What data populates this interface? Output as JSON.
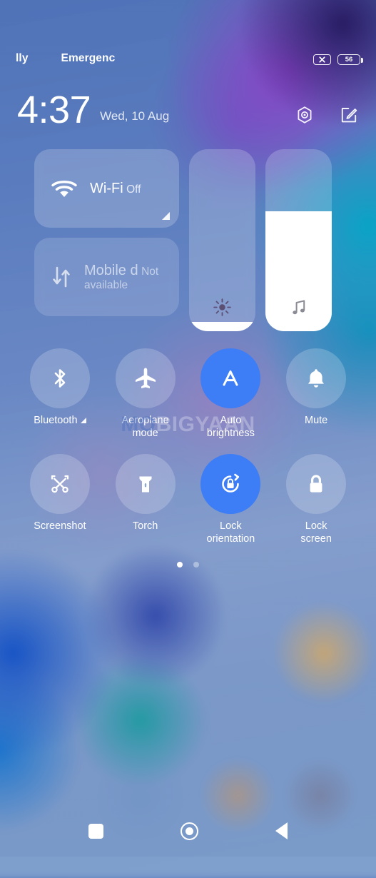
{
  "statusbar": {
    "carrier_left": "lly",
    "carrier_right": "Emergenc",
    "sim_icon": "no-sim-icon",
    "battery_percent": "56"
  },
  "clock": {
    "time": "4:37",
    "date": "Wed, 10 Aug",
    "settings_icon": "settings-hexagon-icon",
    "edit_icon": "edit-tiles-icon"
  },
  "tiles": {
    "wifi": {
      "title": "Wi-Fi",
      "status": "Off",
      "icon": "wifi-icon",
      "expandable": true
    },
    "mobile": {
      "title": "Mobile d",
      "status": "Not available",
      "icon": "mobile-data-icon",
      "expandable": false
    },
    "brightness_slider": {
      "icon": "brightness-sun-icon",
      "level_percent": 5,
      "label": "Brightness"
    },
    "volume_slider": {
      "icon": "music-note-icon",
      "level_percent": 66,
      "label": "Media volume"
    }
  },
  "toggles": {
    "rows": [
      [
        {
          "label": "Bluetooth",
          "icon": "bluetooth-icon",
          "active": false,
          "expandable": true
        },
        {
          "label": "Aeroplane\nmode",
          "icon": "aeroplane-icon",
          "active": false,
          "expandable": false
        },
        {
          "label": "Auto\nbrightness",
          "icon": "auto-brightness-icon",
          "active": true,
          "expandable": false
        },
        {
          "label": "Mute",
          "icon": "bell-icon",
          "active": false,
          "expandable": false
        }
      ],
      [
        {
          "label": "Screenshot",
          "icon": "screenshot-icon",
          "active": false,
          "expandable": false
        },
        {
          "label": "Torch",
          "icon": "torch-icon",
          "active": false,
          "expandable": false
        },
        {
          "label": "Lock\norientation",
          "icon": "lock-orientation-icon",
          "active": true,
          "expandable": false
        },
        {
          "label": "Lock\nscreen",
          "icon": "lock-screen-icon",
          "active": false,
          "expandable": false
        }
      ]
    ]
  },
  "pager": {
    "total": 2,
    "active_index": 0
  },
  "watermark": {
    "text_a": "MO",
    "text_b": "BIGYAAN",
    "full": "MOBIGYAAN"
  },
  "navbar": {
    "recents_label": "Recents",
    "home_label": "Home",
    "back_label": "Back"
  },
  "colors": {
    "accent_active": "#3d7df6",
    "tile_bg": "rgba(255,255,255,0.20)",
    "text_primary": "#ffffff"
  }
}
